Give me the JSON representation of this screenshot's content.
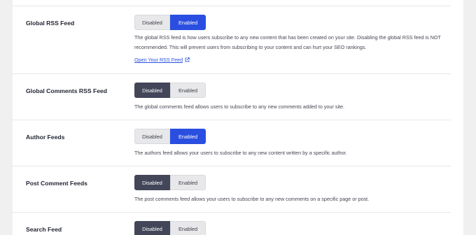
{
  "settings": [
    {
      "label": "Global RSS Feed",
      "disabled_label": "Disabled",
      "enabled_label": "Enabled",
      "state": "enabled",
      "description": "The global RSS feed is how users subscribe to any new content that has been created on your site. Disabling the global RSS feed is NOT recommended. This will prevent users from subscribing to your content and can hurt your SEO rankings.",
      "link_text": "Open Your RSS Feed"
    },
    {
      "label": "Global Comments RSS Feed",
      "disabled_label": "Disabled",
      "enabled_label": "Enabled",
      "state": "disabled",
      "description": "The global comments feed allows users to subscribe to any new comments added to your site."
    },
    {
      "label": "Author Feeds",
      "disabled_label": "Disabled",
      "enabled_label": "Enabled",
      "state": "enabled",
      "description": "The authors feed allows your users to subscribe to any new content written by a specific author."
    },
    {
      "label": "Post Comment Feeds",
      "disabled_label": "Disabled",
      "enabled_label": "Enabled",
      "state": "disabled",
      "description": "The post comments feed allows your users to subscribe to any new comments on a specific page or post."
    },
    {
      "label": "Search Feed",
      "disabled_label": "Disabled",
      "enabled_label": "Enabled",
      "state": "disabled"
    }
  ],
  "colors": {
    "enabled_active": "#2a4fe0",
    "disabled_active": "#434659",
    "inactive": "#e8e8ea",
    "link": "#2a4fe0"
  },
  "icons": {
    "external_link": "external-link-icon"
  }
}
